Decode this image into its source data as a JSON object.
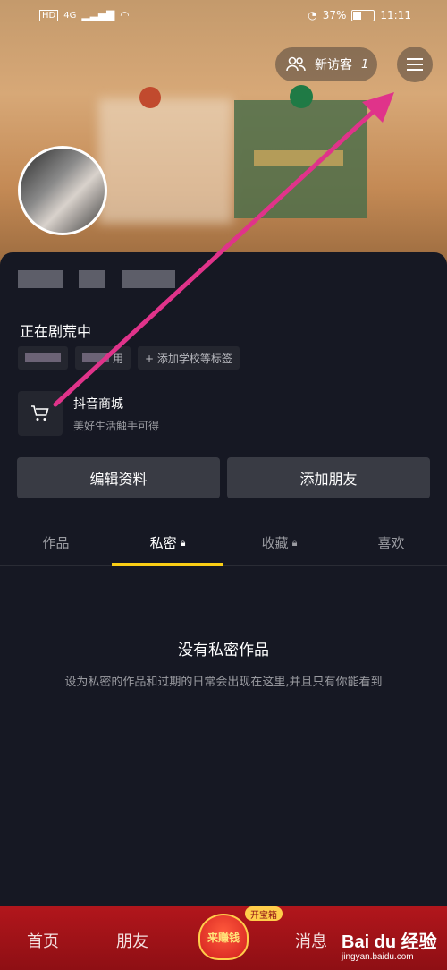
{
  "status_bar": {
    "network": "4G",
    "battery": "37%",
    "time": "11:11"
  },
  "header": {
    "visitor_label": "新访客",
    "visitor_count": "1"
  },
  "profile": {
    "signature": "正在剧荒中",
    "tags": [
      "",
      "用",
      "+ 添加学校等标签"
    ],
    "shop_title": "抖音商城",
    "shop_subtitle": "美好生活触手可得"
  },
  "actions": {
    "edit": "编辑资料",
    "add_friend": "添加朋友"
  },
  "tabs": [
    {
      "label": "作品",
      "locked": false
    },
    {
      "label": "私密",
      "locked": true
    },
    {
      "label": "收藏",
      "locked": true
    },
    {
      "label": "喜欢",
      "locked": false
    }
  ],
  "empty": {
    "title": "没有私密作品",
    "subtitle": "设为私密的作品和过期的日常会出现在这里,并且只有你能看到"
  },
  "bottom_nav": {
    "home": "首页",
    "friends": "朋友",
    "earn": "来赚钱",
    "earn_badge": "开宝箱",
    "messages": "消息"
  },
  "watermark": {
    "brand": "Bai du 经验",
    "url": "jingyan.baidu.com"
  },
  "colors": {
    "accent_tab": "#face15",
    "arrow": "#e0338a",
    "bottom_bar": "#b2161c"
  }
}
